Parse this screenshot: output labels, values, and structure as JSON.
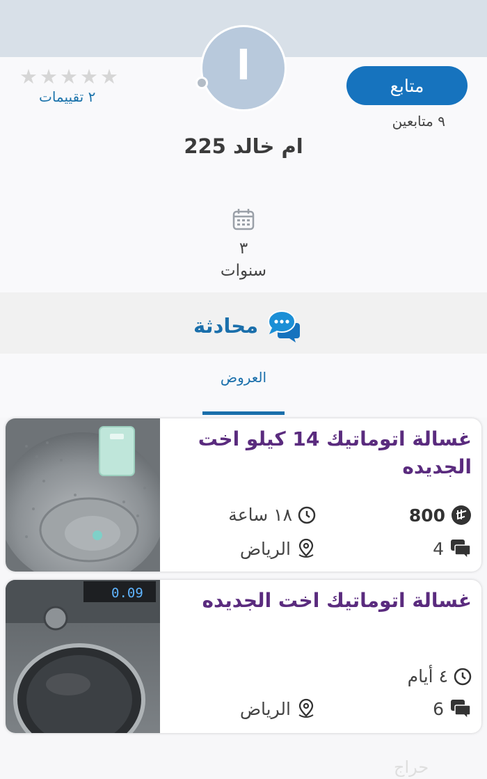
{
  "profile": {
    "avatar_letter": "ا",
    "follow_label": "متابع",
    "followers_text": "٩ متابعين",
    "stars": [
      "★",
      "★",
      "★",
      "★",
      "★"
    ],
    "ratings_text": "٢ تقييمات",
    "name": "ام خالد 225",
    "membership_years": "٣",
    "membership_unit": "سنوات"
  },
  "chat": {
    "label": "محادثة"
  },
  "tabs": [
    {
      "label": "العروض",
      "active": true
    }
  ],
  "listings": [
    {
      "title": "غسالة اتوماتيك 14 كيلو اخت الجديده",
      "price": "800",
      "time": "١٨ ساعة",
      "city": "الرياض",
      "comments": "4"
    },
    {
      "title": "غسالة اتوماتيك اخت الجديده",
      "display_readout": "0.09",
      "time": "٤ أيام",
      "city": "الرياض",
      "comments": "6"
    }
  ],
  "watermark": "حراج",
  "colors": {
    "accent": "#1673be",
    "title": "#5a2b7e",
    "top_band": "#d8e0e8"
  }
}
